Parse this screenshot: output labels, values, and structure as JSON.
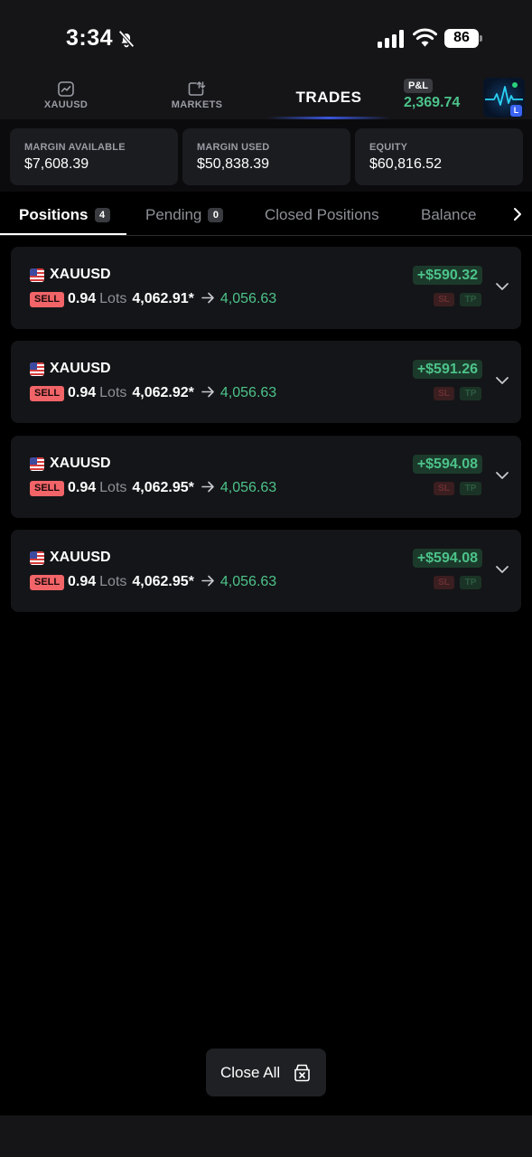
{
  "status_bar": {
    "time": "3:34",
    "battery": "86"
  },
  "top_nav": {
    "items": [
      {
        "label": "XAUUSD",
        "icon": "chart-icon"
      },
      {
        "label": "MARKETS",
        "icon": "markets-icon"
      }
    ],
    "active": "TRADES",
    "pnl_label": "P&L",
    "pnl_value": "2,369.74",
    "avatar_badge": "L"
  },
  "summary": [
    {
      "label": "MARGIN AVAILABLE",
      "value": "$7,608.39"
    },
    {
      "label": "MARGIN USED",
      "value": "$50,838.39"
    },
    {
      "label": "EQUITY",
      "value": "$60,816.52"
    }
  ],
  "tabs": [
    {
      "label": "Positions",
      "count": "4",
      "active": true
    },
    {
      "label": "Pending",
      "count": "0",
      "active": false
    },
    {
      "label": "Closed Positions",
      "active": false
    },
    {
      "label": "Balance",
      "active": false
    }
  ],
  "positions": [
    {
      "symbol": "XAUUSD",
      "side": "SELL",
      "lots": "0.94",
      "lots_unit": "Lots",
      "open_price": "4,062.91*",
      "current_price": "4,056.63",
      "profit": "+$590.32",
      "sl": "SL",
      "tp": "TP"
    },
    {
      "symbol": "XAUUSD",
      "side": "SELL",
      "lots": "0.94",
      "lots_unit": "Lots",
      "open_price": "4,062.92*",
      "current_price": "4,056.63",
      "profit": "+$591.26",
      "sl": "SL",
      "tp": "TP"
    },
    {
      "symbol": "XAUUSD",
      "side": "SELL",
      "lots": "0.94",
      "lots_unit": "Lots",
      "open_price": "4,062.95*",
      "current_price": "4,056.63",
      "profit": "+$594.08",
      "sl": "SL",
      "tp": "TP"
    },
    {
      "symbol": "XAUUSD",
      "side": "SELL",
      "lots": "0.94",
      "lots_unit": "Lots",
      "open_price": "4,062.95*",
      "current_price": "4,056.63",
      "profit": "+$594.08",
      "sl": "SL",
      "tp": "TP"
    }
  ],
  "close_all": {
    "label": "Close All"
  },
  "colors": {
    "profit_green": "#4cc38a",
    "sell_red": "#f16468",
    "accent_blue": "#3b63f2",
    "background": "#000000",
    "card": "#141518"
  }
}
